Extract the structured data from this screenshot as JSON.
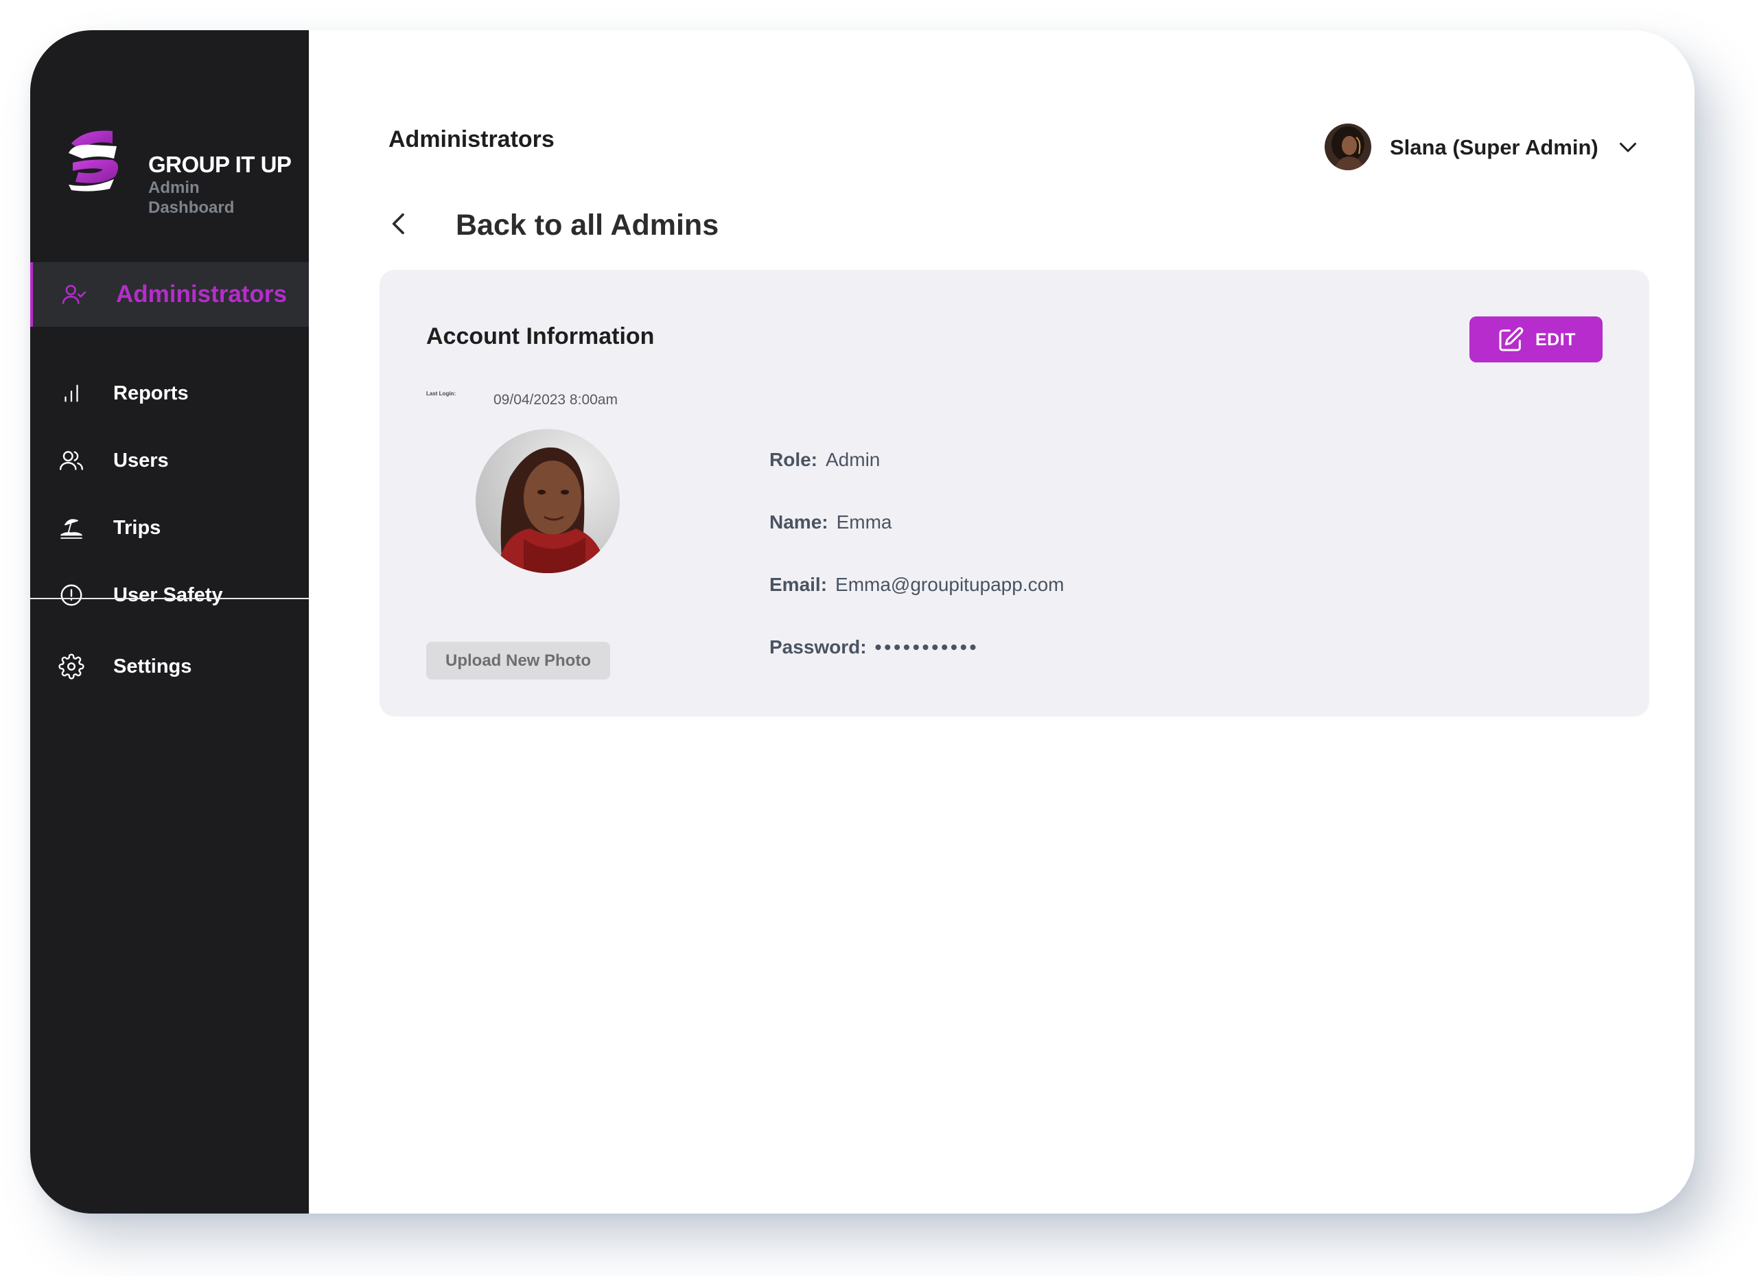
{
  "brand": {
    "title": "GROUP IT UP",
    "subtitle": "Admin Dashboard"
  },
  "sidebar": {
    "items": [
      {
        "label": "Administrators",
        "icon": "user-check-icon",
        "active": true
      },
      {
        "label": "Reports",
        "icon": "bar-chart-icon",
        "active": false
      },
      {
        "label": "Users",
        "icon": "users-icon",
        "active": false
      },
      {
        "label": "Trips",
        "icon": "beach-umbrella-icon",
        "active": false
      },
      {
        "label": "User Safety",
        "icon": "alert-circle-icon",
        "active": false
      },
      {
        "label": "Settings",
        "icon": "gear-icon",
        "active": false
      }
    ]
  },
  "header": {
    "title": "Administrators",
    "user_name": "Slana (Super Admin)"
  },
  "back_link": {
    "label": "Back to all Admins"
  },
  "account": {
    "title": "Account Information",
    "edit_label": "EDIT",
    "last_login_label": "Last Login:",
    "last_login_value": "09/04/2023 8:00am",
    "upload_label": "Upload New Photo",
    "fields": [
      {
        "label": "Role:",
        "value": "Admin"
      },
      {
        "label": "Name:",
        "value": "Emma"
      },
      {
        "label": "Email:",
        "value": "Emma@groupitupapp.com"
      },
      {
        "label": "Password:",
        "value": "•••••••••••"
      }
    ]
  },
  "colors": {
    "accent": "#b72ccc",
    "sidebar_bg": "#1c1c1e",
    "card_bg": "#f1f1f5"
  }
}
